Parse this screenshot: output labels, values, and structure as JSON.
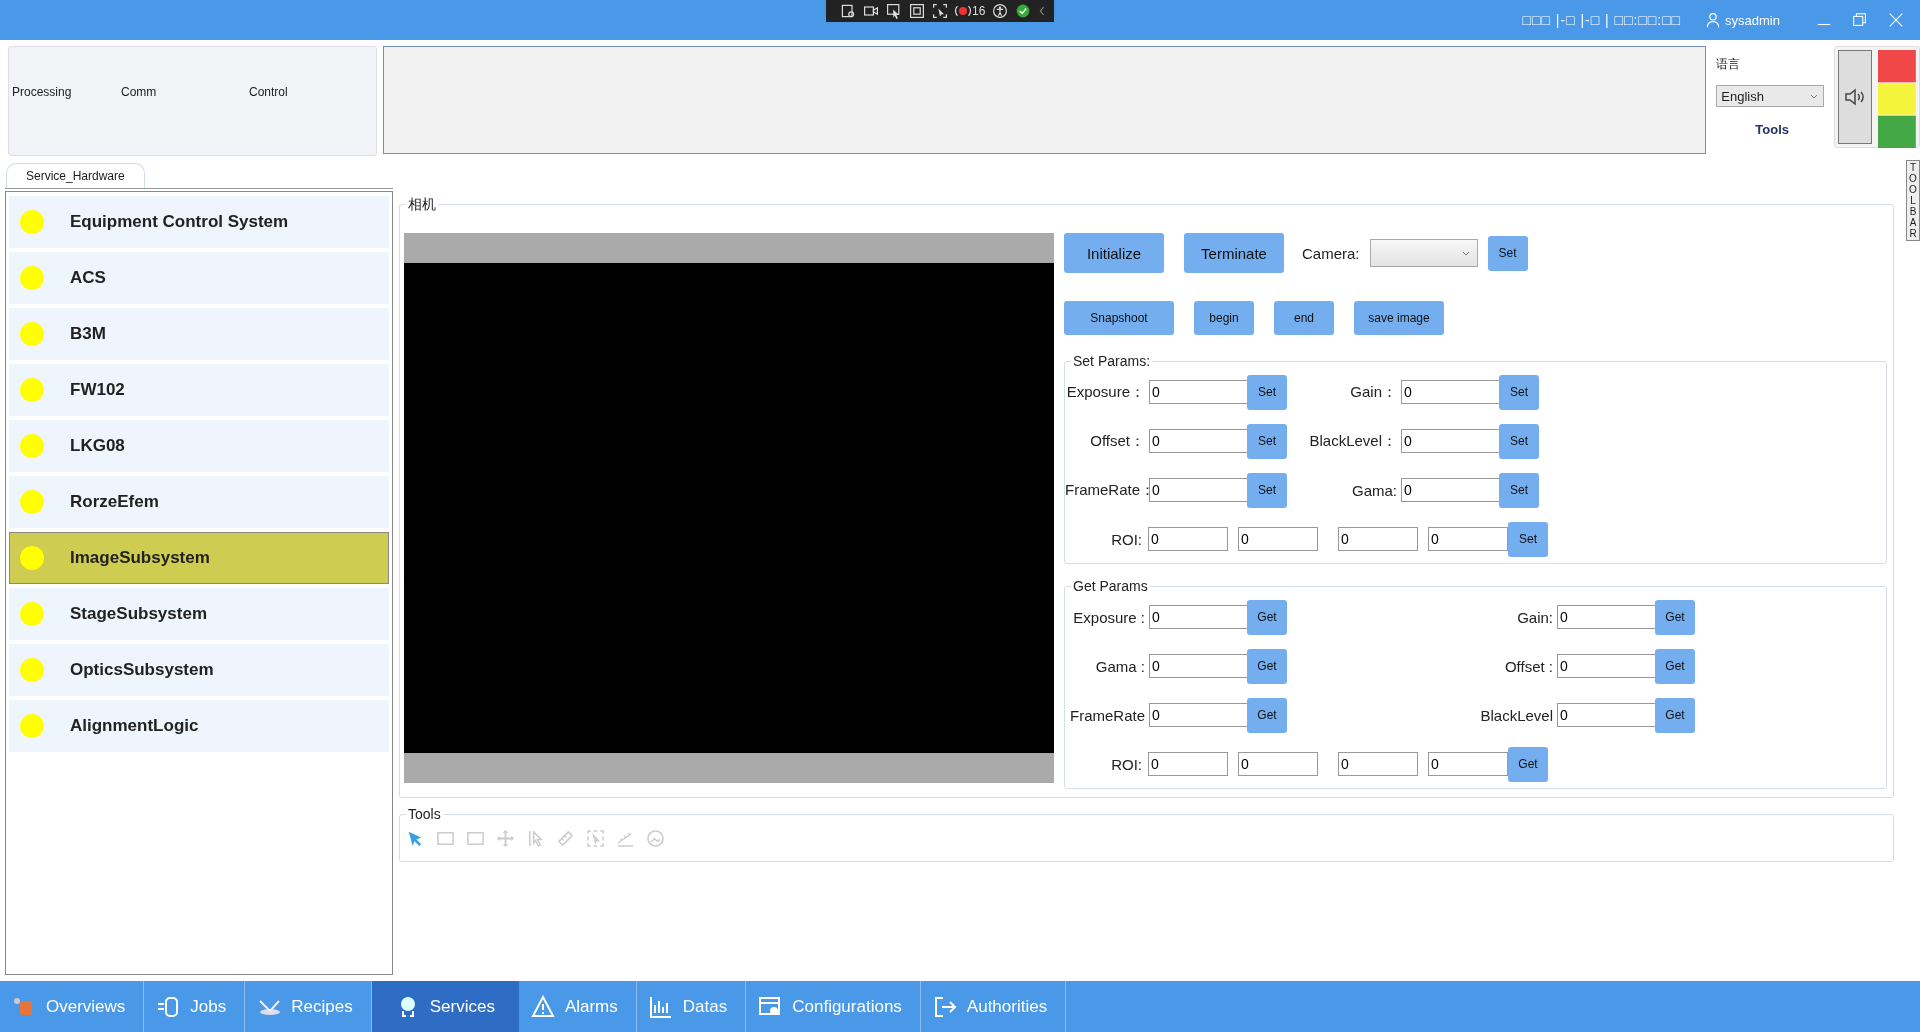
{
  "top_bar": {
    "recorder_count": "16",
    "datetime": "□□□ |-□ |-□ | □□:□□:□□",
    "user": "sysadmin"
  },
  "status_panel": {
    "labels": [
      "Processing",
      "Comm",
      "Control"
    ]
  },
  "language": {
    "label": "语言",
    "value": "English",
    "tools_label": "Tools"
  },
  "side_toolbar_label": "TOOLBAR",
  "tabs": [
    {
      "label": "Service_Hardware",
      "selected": true
    }
  ],
  "subsystems": [
    {
      "name": "Equipment Control System",
      "selected": false
    },
    {
      "name": "ACS",
      "selected": false
    },
    {
      "name": "B3M",
      "selected": false
    },
    {
      "name": "FW102",
      "selected": false
    },
    {
      "name": "LKG08",
      "selected": false
    },
    {
      "name": "RorzeEfem",
      "selected": false
    },
    {
      "name": "ImageSubsystem",
      "selected": true
    },
    {
      "name": "StageSubsystem",
      "selected": false
    },
    {
      "name": "OpticsSubsystem",
      "selected": false
    },
    {
      "name": "AlignmentLogic",
      "selected": false
    }
  ],
  "camera_group": {
    "title": "相机",
    "initialize": "Initialize",
    "terminate": "Terminate",
    "camera_label": "Camera:",
    "set": "Set",
    "actions": [
      "Snapshoot",
      "begin",
      "end",
      "save image"
    ]
  },
  "set_params": {
    "title": "Set Params:",
    "rows": [
      [
        {
          "label": "Exposure：",
          "value": "0",
          "button": "Set"
        },
        {
          "label": "Gain：",
          "value": "0",
          "button": "Set"
        }
      ],
      [
        {
          "label": "Offset：",
          "value": "0",
          "button": "Set"
        },
        {
          "label": "BlackLevel：",
          "value": "0",
          "button": "Set"
        }
      ],
      [
        {
          "label": "FrameRate：",
          "value": "0",
          "button": "Set"
        },
        {
          "label": "Gama:",
          "value": "0",
          "button": "Set"
        }
      ]
    ],
    "roi": {
      "label": "ROI:",
      "values": [
        "0",
        "0",
        "0",
        "0"
      ],
      "button": "Set"
    }
  },
  "get_params": {
    "title": "Get Params",
    "rows": [
      [
        {
          "label": "Exposure :",
          "value": "0",
          "button": "Get"
        },
        {
          "label": "Gain:",
          "value": "0",
          "button": "Get"
        }
      ],
      [
        {
          "label": "Gama :",
          "value": "0",
          "button": "Get"
        },
        {
          "label": "Offset :",
          "value": "0",
          "button": "Get"
        }
      ],
      [
        {
          "label": "FrameRate",
          "value": "0",
          "button": "Get"
        },
        {
          "label": "BlackLevel",
          "value": "0",
          "button": "Get"
        }
      ]
    ],
    "roi": {
      "label": "ROI:",
      "values": [
        "0",
        "0",
        "0",
        "0"
      ],
      "button": "Get"
    }
  },
  "tools": {
    "title": "Tools",
    "items": [
      {
        "selected": true
      },
      {
        "selected": false
      },
      {
        "selected": false
      },
      {
        "selected": false
      },
      {
        "selected": false
      },
      {
        "selected": false
      },
      {
        "selected": false
      },
      {
        "selected": false
      },
      {
        "selected": false
      }
    ]
  },
  "nav": [
    {
      "label": "Overviews",
      "selected": false
    },
    {
      "label": "Jobs",
      "selected": false
    },
    {
      "label": "Recipes",
      "selected": false
    },
    {
      "label": "Services",
      "selected": true
    },
    {
      "label": "Alarms",
      "selected": false
    },
    {
      "label": "Datas",
      "selected": false
    },
    {
      "label": "Configurations",
      "selected": false
    },
    {
      "label": "Authorities",
      "selected": false
    }
  ]
}
